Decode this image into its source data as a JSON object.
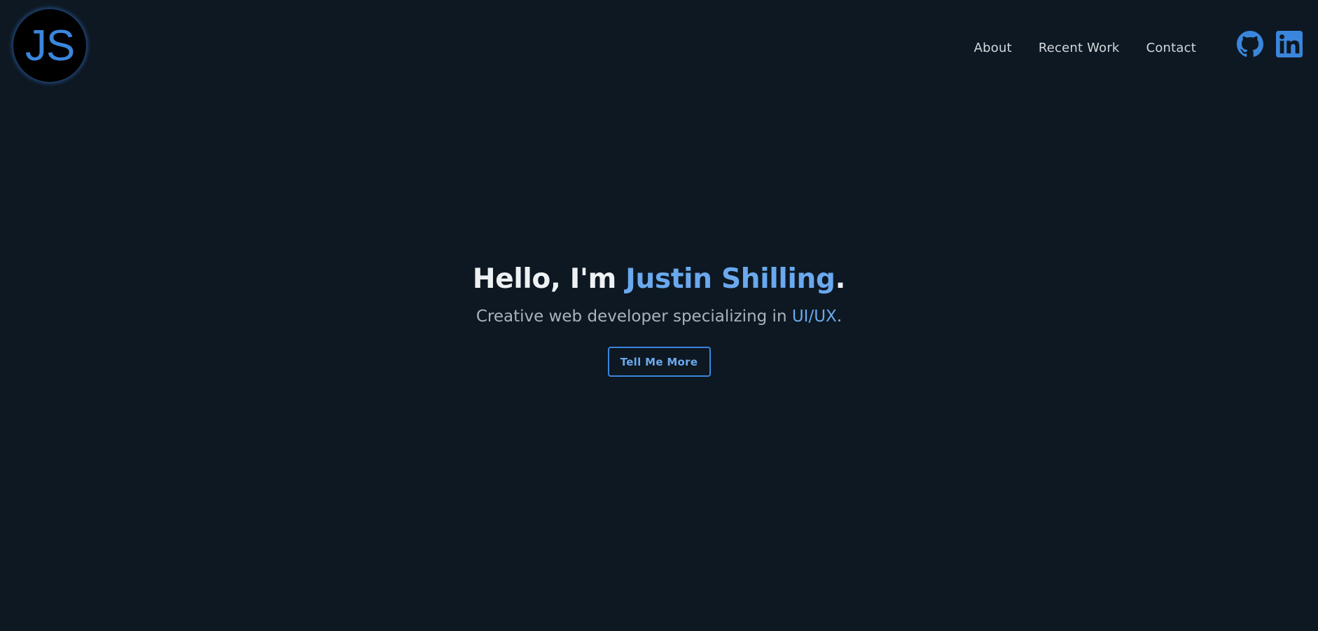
{
  "logo": {
    "text": "JS"
  },
  "nav": {
    "items": [
      {
        "label": "About"
      },
      {
        "label": "Recent Work"
      },
      {
        "label": "Contact"
      }
    ]
  },
  "social": [
    {
      "icon": "github-icon"
    },
    {
      "icon": "linkedin-icon"
    }
  ],
  "hero": {
    "greeting": "Hello, I'm ",
    "name": "Justin Shilling",
    "greeting_end": ".",
    "tagline_prefix": "Creative web developer specializing in ",
    "tagline_accent": "UI/UX",
    "tagline_end": ".",
    "button_label": "Tell Me More"
  },
  "colors": {
    "background": "#0e1822",
    "accent": "#3a86dc",
    "accent_light": "#6aa9ee"
  }
}
